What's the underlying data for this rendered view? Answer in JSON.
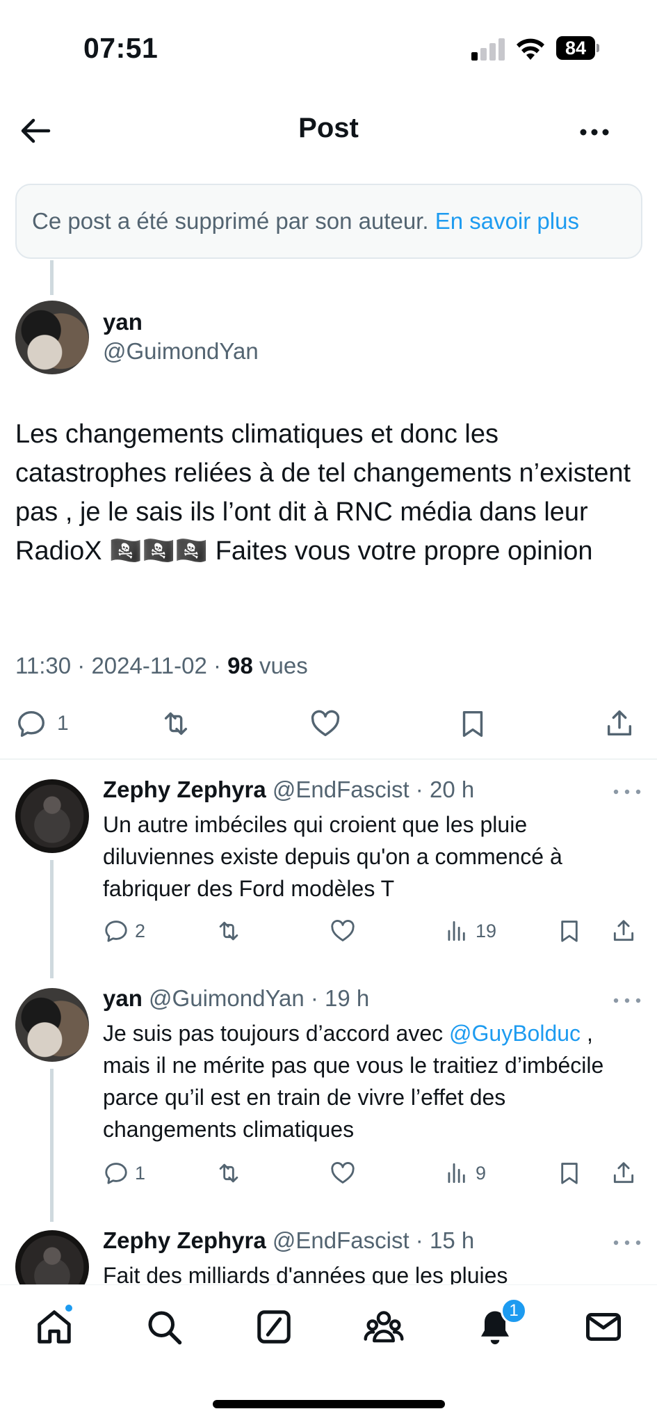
{
  "status_bar": {
    "time": "07:51",
    "battery": "84"
  },
  "header": {
    "title": "Post"
  },
  "deleted_notice": {
    "text": "Ce post a été supprimé par son auteur. ",
    "link": "En savoir plus"
  },
  "main_post": {
    "author_name": "yan",
    "author_handle": "@GuimondYan",
    "text": "Les changements climatiques et donc les catastrophes reliées à de tel changements n’existent pas , je le sais ils l’ont dit à RNC média dans leur RadioX 🏴‍☠️🏴‍☠️🏴‍☠️ Faites vous votre propre opinion",
    "time": "11:30 · 2024-11-02 · ",
    "views_count": "98",
    "views_label": " vues",
    "reply_count": "1"
  },
  "replies": [
    {
      "name": "Zephy Zephyra",
      "handle": "@EndFascist · 20 h",
      "text": "Un autre imbéciles qui croient que les pluie diluviennes existe depuis qu'on a commencé à fabriquer des Ford modèles T",
      "reply_count": "2",
      "views": "19"
    },
    {
      "name": "yan",
      "handle": "@GuimondYan · 19 h",
      "text_before": "Je suis pas toujours d’accord avec ",
      "mention": "@GuyBolduc",
      "text_after": " , mais il ne mérite pas que vous le traitiez d’imbécile parce qu’il est en train de vivre l’effet des changements climatiques",
      "reply_count": "1",
      "views": "9"
    },
    {
      "name": "Zephy Zephyra",
      "handle": "@EndFascist · 15 h",
      "text": "Fait des milliards d'années que les pluies"
    }
  ],
  "tab_bar": {
    "notifications_badge": "1"
  },
  "icons": {
    "back": "back-arrow-icon",
    "more": "more-icon",
    "reply": "reply-icon",
    "repost": "repost-icon",
    "like": "heart-icon",
    "bookmark": "bookmark-icon",
    "share": "share-icon",
    "views": "views-icon",
    "home": "home-icon",
    "search": "search-icon",
    "compose": "compose-icon",
    "communities": "communities-icon",
    "notifications": "bell-icon",
    "messages": "mail-icon"
  },
  "colors": {
    "accent": "#1d9bf0",
    "secondary_text": "#536471",
    "primary_text": "#0f1419"
  }
}
